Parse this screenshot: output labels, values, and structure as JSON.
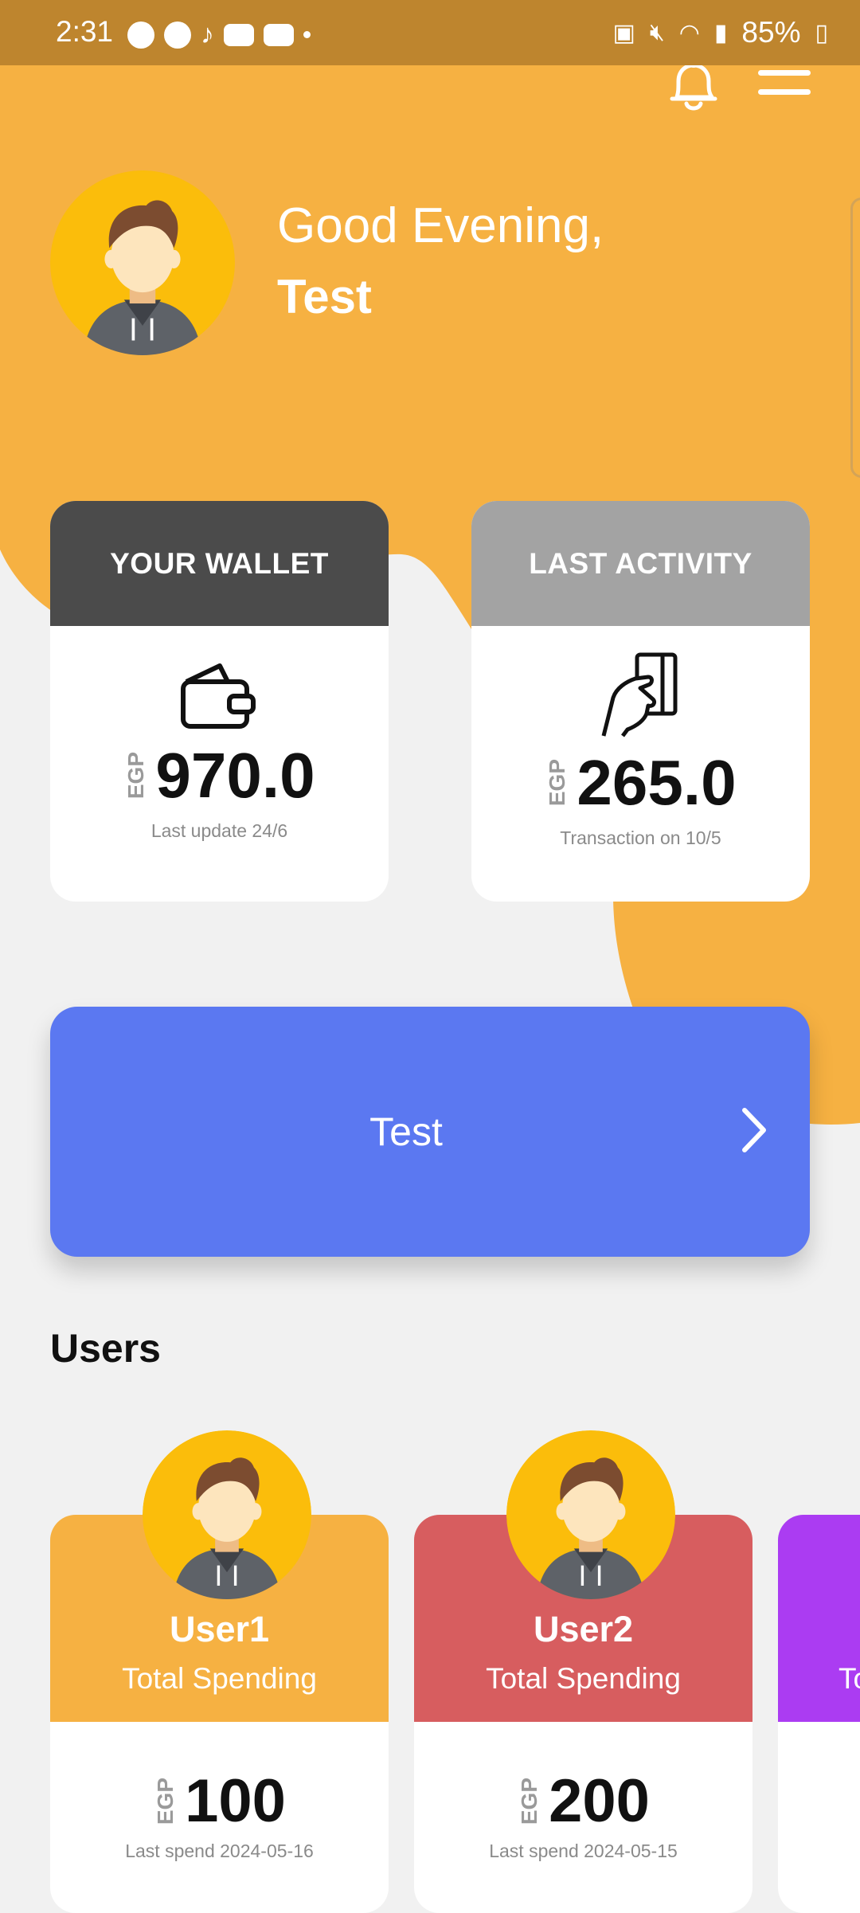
{
  "status_bar": {
    "time": "2:31",
    "battery": "85%"
  },
  "greeting": {
    "text": "Good Evening,",
    "name": "Test"
  },
  "cards": {
    "wallet": {
      "title": "YOUR WALLET",
      "currency": "EGP",
      "amount": "970.0",
      "subtitle": "Last update 24/6"
    },
    "activity": {
      "title": "LAST ACTIVITY",
      "currency": "EGP",
      "amount": "265.0",
      "subtitle": "Transaction on 10/5"
    }
  },
  "action": {
    "label": "Test"
  },
  "users": {
    "title": "Users",
    "items": [
      {
        "name": "User1",
        "label": "Total Spending",
        "currency": "EGP",
        "amount": "100",
        "last_spend": "Last spend 2024-05-16"
      },
      {
        "name": "User2",
        "label": "Total Spending",
        "currency": "EGP",
        "amount": "200",
        "last_spend": "Last spend 2024-05-15"
      },
      {
        "name": "",
        "label": "To",
        "currency": "",
        "amount": "",
        "last_spend": ""
      }
    ]
  },
  "colors": {
    "brand_orange": "#f6b142",
    "status_bar": "#be852e",
    "wallet_header": "#4b4b4b",
    "activity_header": "#a3a3a3",
    "action_button": "#5b78f1",
    "user1": "#f6b142",
    "user2": "#d75d5f",
    "user3": "#ab3cf2"
  }
}
